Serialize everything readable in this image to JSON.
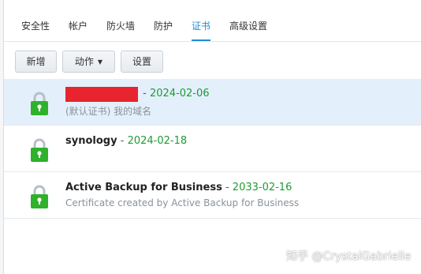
{
  "tabs": [
    {
      "label": "安全性",
      "active": false
    },
    {
      "label": "帐户",
      "active": false
    },
    {
      "label": "防火墙",
      "active": false
    },
    {
      "label": "防护",
      "active": false
    },
    {
      "label": "证书",
      "active": true
    },
    {
      "label": "高级设置",
      "active": false
    }
  ],
  "toolbar": {
    "add_label": "新增",
    "action_label": "动作",
    "settings_label": "设置"
  },
  "certificates": [
    {
      "name": "",
      "name_redacted": true,
      "separator": "-",
      "expiry": "2024-02-06",
      "description": "(默认证书) 我的域名",
      "selected": true
    },
    {
      "name": "synology",
      "separator": "-",
      "expiry": "2024-02-18",
      "description": "",
      "selected": false
    },
    {
      "name": "Active Backup for Business",
      "separator": "-",
      "expiry": "2033-02-16",
      "description": "Certificate created by Active Backup for Business",
      "selected": false
    }
  ],
  "icons": {
    "certificate": "lock-icon",
    "dropdown": "caret-down-icon"
  },
  "colors": {
    "accent": "#1f8fd6",
    "expiry_date": "#1e9a35",
    "lock": "#2fb12c",
    "selected_row": "#e3f0fb"
  },
  "watermark": "知乎 @CrystalGabrielle"
}
